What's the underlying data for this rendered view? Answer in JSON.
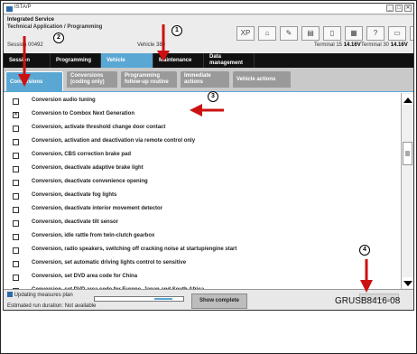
{
  "window": {
    "app_title": "ISTA/P",
    "controls": [
      "_",
      "□",
      "✕"
    ]
  },
  "header": {
    "title_line1": "Integrated Service",
    "title_line2": "Technical Application / Programming",
    "session_label": "Session",
    "session_value": "00492",
    "vehicle_label": "Vehicle",
    "vehicle_value": "389",
    "terminal15_label": "Terminal 15",
    "terminal15_value": "14.16V",
    "terminal30_label": "Terminal 30",
    "terminal30_value": "14.16V",
    "toolbar_icons": [
      "XP",
      "home-icon",
      "wrench-icon",
      "book-icon",
      "window-icon",
      "print-icon",
      "help-icon",
      "minimize-icon",
      "close-icon"
    ],
    "toolbar_glyphs": [
      "XP",
      "⌂",
      "✎",
      "▤",
      "▯",
      "▦",
      "?",
      "▭",
      "✕"
    ]
  },
  "main_tabs": [
    {
      "label": "Session",
      "active": false
    },
    {
      "label": "Programming",
      "active": false
    },
    {
      "label": "Vehicle",
      "active": true
    },
    {
      "label": "Maintenance",
      "active": false
    },
    {
      "label": "Data\nmanagement",
      "active": false
    }
  ],
  "sub_tabs": [
    {
      "label": "Conversions",
      "active": true
    },
    {
      "label": "Conversions\n(coding only)",
      "active": false
    },
    {
      "label": "Programming\nfollow-up routine",
      "active": false
    },
    {
      "label": "Immediate\nactions",
      "active": false
    },
    {
      "label": "Vehicle actions",
      "active": false
    }
  ],
  "conversions": [
    {
      "label": "Conversion audio tuning",
      "checked": false
    },
    {
      "label": "Conversion to Combox Next Generation",
      "checked": true
    },
    {
      "label": "Conversion, activate threshold change door contact",
      "checked": false
    },
    {
      "label": "Conversion, activation and deactivation via remote control only",
      "checked": false
    },
    {
      "label": "Conversion, CBS correction brake pad",
      "checked": false
    },
    {
      "label": "Conversion, deactivate adaptive brake light",
      "checked": false
    },
    {
      "label": "Conversion, deactivate convenience opening",
      "checked": false
    },
    {
      "label": "Conversion, deactivate fog lights",
      "checked": false
    },
    {
      "label": "Conversion, deactivate interior movement detector",
      "checked": false
    },
    {
      "label": "Conversion, deactivate tilt sensor",
      "checked": false
    },
    {
      "label": "Conversion, idle rattle from twin-clutch gearbox",
      "checked": false
    },
    {
      "label": "Conversion, radio speakers, switching off cracking noise at startup/engine start",
      "checked": false
    },
    {
      "label": "Conversion, set automatic driving lights control to sensitive",
      "checked": false
    },
    {
      "label": "Conversion, set DVD area code for China",
      "checked": false
    },
    {
      "label": "Conversion, set DVD area code for Europe, Japan and South Africa",
      "checked": false
    }
  ],
  "footer": {
    "updating_text": "Updating measures plan",
    "estimated_text": "Estimated run duration: Not available",
    "progress_fraction": 0.2,
    "show_complete_label": "Show complete"
  },
  "annotations": {
    "callouts": [
      "1",
      "2",
      "3",
      "4"
    ],
    "reference_code": "GRUSB8416-08"
  },
  "colors": {
    "accent": "#5aa7d4",
    "nav_bg": "#111111",
    "arrow": "#cc1111"
  }
}
